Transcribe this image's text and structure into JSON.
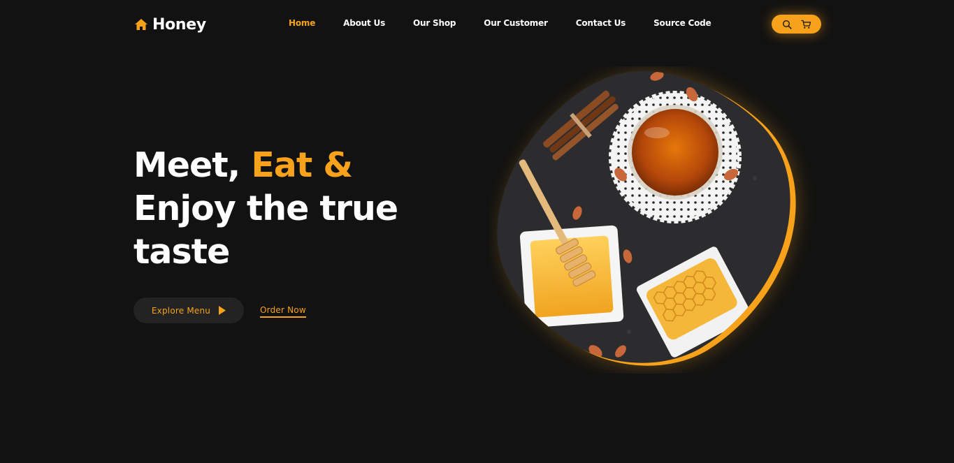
{
  "brand": {
    "name": "Honey",
    "icon": "home-icon"
  },
  "nav": {
    "items": [
      {
        "label": "Home",
        "active": true
      },
      {
        "label": "About Us",
        "active": false
      },
      {
        "label": "Our Shop",
        "active": false
      },
      {
        "label": "Our Customer",
        "active": false
      },
      {
        "label": "Contact Us",
        "active": false
      },
      {
        "label": "Source Code",
        "active": false
      }
    ]
  },
  "actions": {
    "search_icon": "search-icon",
    "cart_icon": "cart-icon"
  },
  "hero": {
    "line1_plain": "Meet, ",
    "line1_accent": "Eat &",
    "line2": "Enjoy the true",
    "line3": "taste",
    "explore_label": "Explore Menu",
    "order_label": "Order Now"
  },
  "colors": {
    "background": "#121212",
    "accent": "#f7a21a",
    "button_dark": "#232323",
    "text": "#ffffff"
  }
}
